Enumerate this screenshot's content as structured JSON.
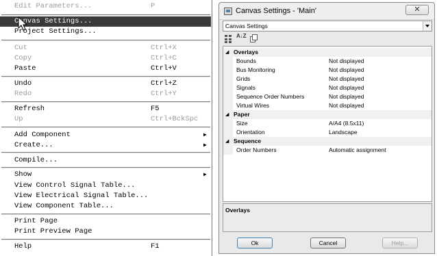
{
  "menu": {
    "items": [
      {
        "label": "Edit Parameters...",
        "shortcut": "P",
        "disabled": true
      },
      {
        "label": "Canvas Settings...",
        "shortcut": "",
        "highlighted": true
      },
      {
        "label": "Project Settings...",
        "shortcut": ""
      },
      {
        "label": "Cut",
        "shortcut": "Ctrl+X",
        "disabled": true
      },
      {
        "label": "Copy",
        "shortcut": "Ctrl+C",
        "disabled": true
      },
      {
        "label": "Paste",
        "shortcut": "Ctrl+V"
      },
      {
        "label": "Undo",
        "shortcut": "Ctrl+Z"
      },
      {
        "label": "Redo",
        "shortcut": "Ctrl+Y",
        "disabled": true
      },
      {
        "label": "Refresh",
        "shortcut": "F5"
      },
      {
        "label": "Up",
        "shortcut": "Ctrl+BckSpc",
        "disabled": true
      },
      {
        "label": "Add Component",
        "shortcut": "",
        "submenu": true
      },
      {
        "label": "Create...",
        "shortcut": "",
        "submenu": true
      },
      {
        "label": "Compile...",
        "shortcut": ""
      },
      {
        "label": "Show",
        "shortcut": "",
        "submenu": true
      },
      {
        "label": "View Control Signal Table...",
        "shortcut": ""
      },
      {
        "label": "View Electrical Signal Table...",
        "shortcut": ""
      },
      {
        "label": "View Component Table...",
        "shortcut": ""
      },
      {
        "label": "Print Page",
        "shortcut": ""
      },
      {
        "label": "Print Preview Page",
        "shortcut": ""
      },
      {
        "label": "Help",
        "shortcut": "F1"
      }
    ]
  },
  "dialog": {
    "title": "Canvas Settings - 'Main'",
    "close_glyph": "✕",
    "selector_value": "Canvas Settings",
    "sort_az_label": "A↓Z",
    "categories": [
      {
        "name": "Overlays",
        "properties": [
          {
            "name": "Bounds",
            "value": "Not displayed"
          },
          {
            "name": "Bus Monitoring",
            "value": "Not displayed"
          },
          {
            "name": "Grids",
            "value": "Not displayed"
          },
          {
            "name": "Signals",
            "value": "Not displayed"
          },
          {
            "name": "Sequence Order Numbers",
            "value": "Not displayed"
          },
          {
            "name": "Virtual Wires",
            "value": "Not displayed"
          }
        ]
      },
      {
        "name": "Paper",
        "properties": [
          {
            "name": "Size",
            "value": "A/A4 (8.5x11)"
          },
          {
            "name": "Orientation",
            "value": "Landscape"
          }
        ]
      },
      {
        "name": "Sequence",
        "properties": [
          {
            "name": "Order Numbers",
            "value": "Automatic assignment"
          }
        ]
      }
    ],
    "description_title": "Overlays",
    "buttons": {
      "ok": "Ok",
      "cancel": "Cancel",
      "help": "Help..."
    }
  },
  "colors": {
    "menu_highlight": "#3a3a3a",
    "disabled_text": "#9a9a9a",
    "dialog_bg": "#e9e9e9"
  },
  "icons": [
    "mouse-pointer-icon",
    "dialog-app-icon",
    "close-icon",
    "dropdown-arrow-icon",
    "categorized-view-icon",
    "sort-alphabetical-icon",
    "property-pages-icon",
    "collapse-icon",
    "submenu-arrow-icon"
  ]
}
